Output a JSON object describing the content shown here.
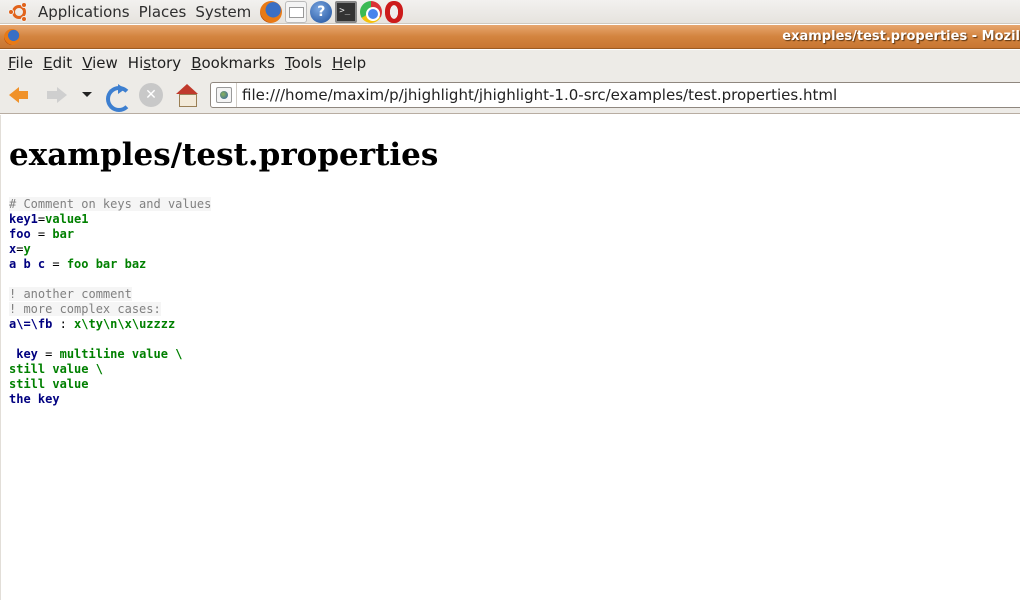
{
  "panel": {
    "menus": [
      "Applications",
      "Places",
      "System"
    ],
    "launchers": [
      "firefox-icon",
      "mail-icon",
      "help-icon",
      "terminal-icon",
      "chrome-icon",
      "opera-icon"
    ]
  },
  "window": {
    "title": "examples/test.properties - Mozil"
  },
  "menubar": {
    "items": [
      {
        "label": "File",
        "accel": "F",
        "rest": "ile"
      },
      {
        "label": "Edit",
        "accel": "E",
        "rest": "dit"
      },
      {
        "label": "View",
        "accel": "V",
        "rest": "iew"
      },
      {
        "label": "History",
        "pre": "Hi",
        "accel": "s",
        "rest": "tory"
      },
      {
        "label": "Bookmarks",
        "accel": "B",
        "rest": "ookmarks"
      },
      {
        "label": "Tools",
        "accel": "T",
        "rest": "ools"
      },
      {
        "label": "Help",
        "accel": "H",
        "rest": "elp"
      }
    ]
  },
  "navbar": {
    "url": "file:///home/maxim/p/jhighlight/jhighlight-1.0-src/examples/test.properties.html"
  },
  "page": {
    "title": "examples/test.properties",
    "lines": [
      [
        {
          "t": "cmt",
          "v": "# Comment on keys and values"
        }
      ],
      [
        {
          "t": "key",
          "v": "key1"
        },
        {
          "t": "sep",
          "v": "="
        },
        {
          "t": "val",
          "v": "value1"
        }
      ],
      [
        {
          "t": "key",
          "v": "foo"
        },
        {
          "t": "sep",
          "v": " = "
        },
        {
          "t": "val",
          "v": "bar"
        }
      ],
      [
        {
          "t": "key",
          "v": "x"
        },
        {
          "t": "sep",
          "v": "="
        },
        {
          "t": "val",
          "v": "y"
        }
      ],
      [
        {
          "t": "key",
          "v": "a b c"
        },
        {
          "t": "sep",
          "v": " = "
        },
        {
          "t": "val",
          "v": "foo bar baz"
        }
      ],
      [],
      [
        {
          "t": "cmt",
          "v": "! another comment"
        }
      ],
      [
        {
          "t": "cmt",
          "v": "! more complex cases:"
        }
      ],
      [
        {
          "t": "key",
          "v": "a\\=\\fb"
        },
        {
          "t": "sep",
          "v": " : "
        },
        {
          "t": "val",
          "v": "x\\ty\\n\\x\\uzzzz"
        }
      ],
      [],
      [
        {
          "t": "sep",
          "v": " "
        },
        {
          "t": "key",
          "v": "key"
        },
        {
          "t": "sep",
          "v": " = "
        },
        {
          "t": "val",
          "v": "multiline value \\"
        }
      ],
      [
        {
          "t": "val",
          "v": "still value \\"
        }
      ],
      [
        {
          "t": "val",
          "v": "still value"
        }
      ],
      [
        {
          "t": "key",
          "v": "the key"
        }
      ]
    ]
  },
  "colors": {
    "comment": "#808080",
    "key": "#000080",
    "value": "#008000",
    "titlebar": "#d3843f"
  }
}
